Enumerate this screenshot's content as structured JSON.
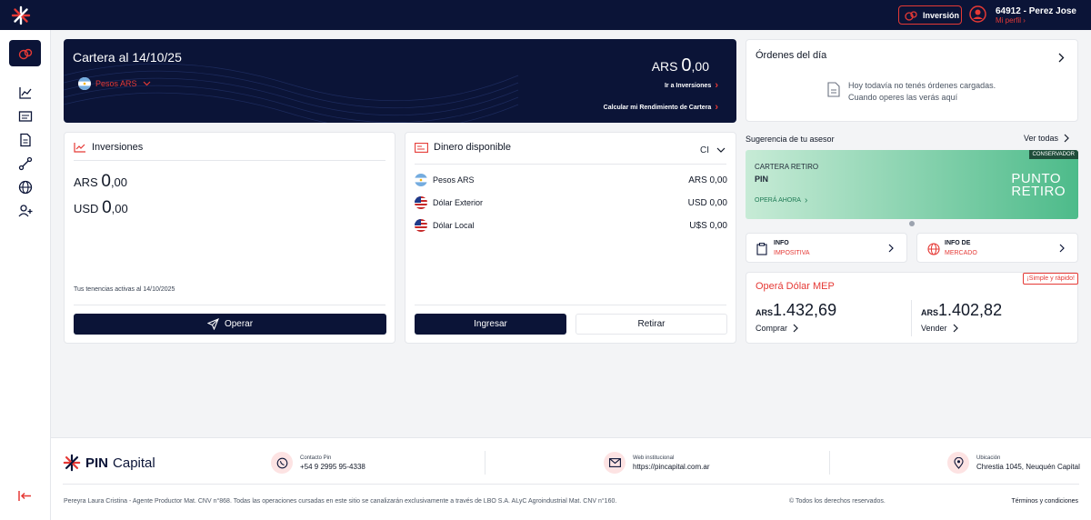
{
  "topbar": {
    "investment_label": "Inversión",
    "user_name": "64912 - Perez Jose",
    "profile_link": "Mi perfil"
  },
  "portfolio": {
    "title": "Cartera al 14/10/25",
    "currency_selector": "Pesos ARS",
    "amount_currency": "ARS",
    "amount_integer": "0",
    "amount_decimal": ",00",
    "link_investments": "Ir a Inversiones",
    "link_performance": "Calcular mi Rendimiento de Cartera"
  },
  "investments": {
    "title": "Inversiones",
    "ars_label": "ARS",
    "ars_integer": "0",
    "ars_decimal": ",00",
    "usd_label": "USD",
    "usd_integer": "0",
    "usd_decimal": ",00",
    "holdings_note": "Tus tenencias activas al 14/10/2025",
    "operate_button": "Operar"
  },
  "cash": {
    "title": "Dinero disponible",
    "account_selector": "CI",
    "rows": [
      {
        "label": "Pesos ARS",
        "value": "ARS 0,00"
      },
      {
        "label": "Dólar Exterior",
        "value": "USD 0,00"
      },
      {
        "label": "Dólar Local",
        "value": "U$S 0,00"
      }
    ],
    "deposit_button": "Ingresar",
    "withdraw_button": "Retirar"
  },
  "orders": {
    "title": "Órdenes del día",
    "empty_line1": "Hoy todavía no tenés órdenes cargadas.",
    "empty_line2": "Cuando operes las verás aquí"
  },
  "advisor": {
    "title": "Sugerencia de tu asesor",
    "see_all": "Ver todas",
    "promo": {
      "badge": "CONSERVADOR",
      "line1": "CARTERA RETIRO",
      "line2": "PIN",
      "cta": "OPERÁ AHORA",
      "brand_line1": "PUNTO",
      "brand_line2": "RETIRO"
    }
  },
  "info_cards": [
    {
      "line1": "INFO",
      "line2": "IMPOSITIVA"
    },
    {
      "line1": "INFO DE",
      "line2": "MERCADO"
    }
  ],
  "mep": {
    "title": "Operá Dólar MEP",
    "badge": "¡Simple y rápido!",
    "buy_currency": "ARS",
    "buy_value": "1.432,69",
    "buy_label": "Comprar",
    "sell_currency": "ARS",
    "sell_value": "1.402,82",
    "sell_label": "Vender"
  },
  "footer": {
    "brand": "PIN",
    "brand_suffix": "Capital",
    "contact_label": "Contacto Pin",
    "contact_value": "+54 9 2995 95-4338",
    "web_label": "Web institucional",
    "web_value": "https://pincapital.com.ar",
    "location_label": "Ubicación",
    "location_value": "Chrestia 1045, Neuquén Capital",
    "legal": "Pereyra Laura Cristina - Agente Productor Mat. CNV n°868. Todas las operaciones cursadas en este sitio se canalizarán exclusivamente a través de LBO S.A. ALyC Agroindustrial Mat. CNV n°160.",
    "rights": "© Todos los derechos reservados.",
    "terms": "Términos y condiciones"
  },
  "colors": {
    "navy": "#0b1437",
    "accent_red": "#e53935",
    "promo_green": "#4dbb8a"
  }
}
